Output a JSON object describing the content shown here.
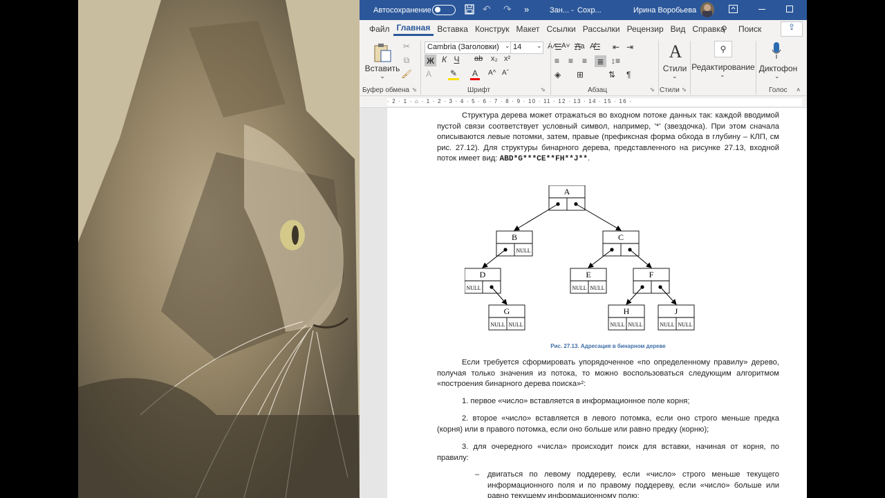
{
  "window": {
    "autosave_label": "Автосохранение",
    "doc_title": "Зан...",
    "save_state": "Сохр...",
    "user_name": "Ирина Воробьева"
  },
  "tabs": [
    "Файл",
    "Главная",
    "Вставка",
    "Конструк",
    "Макет",
    "Ссылки",
    "Рассылки",
    "Рецензир",
    "Вид",
    "Справка"
  ],
  "search": {
    "label": "Поиск"
  },
  "ribbon": {
    "paste_label": "Вставить",
    "clipboard_group": "Буфер обмена",
    "font_name": "Cambria (Заголовки)",
    "font_size": "14",
    "font_group": "Шрифт",
    "bold": "Ж",
    "italic": "К",
    "underline": "Ч",
    "paragraph_group": "Абзац",
    "styles_label": "Стили",
    "styles_group": "Стили",
    "editing_label": "Редактирование",
    "dictate_label": "Диктофон",
    "voice_group": "Голос"
  },
  "ruler": {
    "marks": "· 2 · 1 · ⌂ · 1 · 2 · 3 · 4 · 5 · 6 · 7 · 8 · 9 · 10 · 11 · 12 · 13 · 14 · 15 · 16 ·"
  },
  "document": {
    "p1_a": "Структура дерева может отражаться во входном потоке данных так: каждой вводимой пустой связи соответствует условный символ, например, '*' (звездочка). При этом сначала описываются левые потомки, затем, правые (префиксная форма обхода в глубину – КЛП, см рис. 27.12). Для структуры бинарного дерева, представленного на рисунке 27.13, входной поток имеет вид: ",
    "p1_code": "ABD*G***CE**FH**J**",
    "p1_end": ".",
    "caption": "Рис. 27.13. Адресация в бинарном дереве",
    "p2": "Если требуется сформировать упорядоченное «по определенному правилу» дерево, получая только значения из потока, то можно воспользоваться следующим алгоритмом «построения бинарного дерева поиска»²:",
    "item1": "1. первое «число» вставляется в информационное поле корня;",
    "item2": "2. второе «число» вставляется в левого потомка, если оно строго меньше предка (корня) или в правого потомка, если оно больше или равно предку (корню);",
    "item3": "3. для очередного «числа» происходит поиск для вставки, начиная от корня, по правилу:",
    "dash": "–",
    "sub1": "двигаться по левому поддереву, если «число» строго меньше текущего информационного поля и по правому поддереву, если «число» больше или равно текущему информационному полю;"
  },
  "tree": {
    "nodes": [
      {
        "label": "A",
        "left": "",
        "right": ""
      },
      {
        "label": "B",
        "left": "",
        "right": "NULL"
      },
      {
        "label": "C",
        "left": "",
        "right": ""
      },
      {
        "label": "D",
        "left": "NULL",
        "right": ""
      },
      {
        "label": "E",
        "left": "NULL",
        "right": "NULL"
      },
      {
        "label": "F",
        "left": "",
        "right": ""
      },
      {
        "label": "G",
        "left": "NULL",
        "right": "NULL"
      },
      {
        "label": "H",
        "left": "NULL",
        "right": "NULL"
      },
      {
        "label": "J",
        "left": "NULL",
        "right": "NULL"
      }
    ]
  },
  "colors": {
    "titlebar": "#2b579a",
    "accent": "#2b579a",
    "caption": "#3e6ea7"
  }
}
